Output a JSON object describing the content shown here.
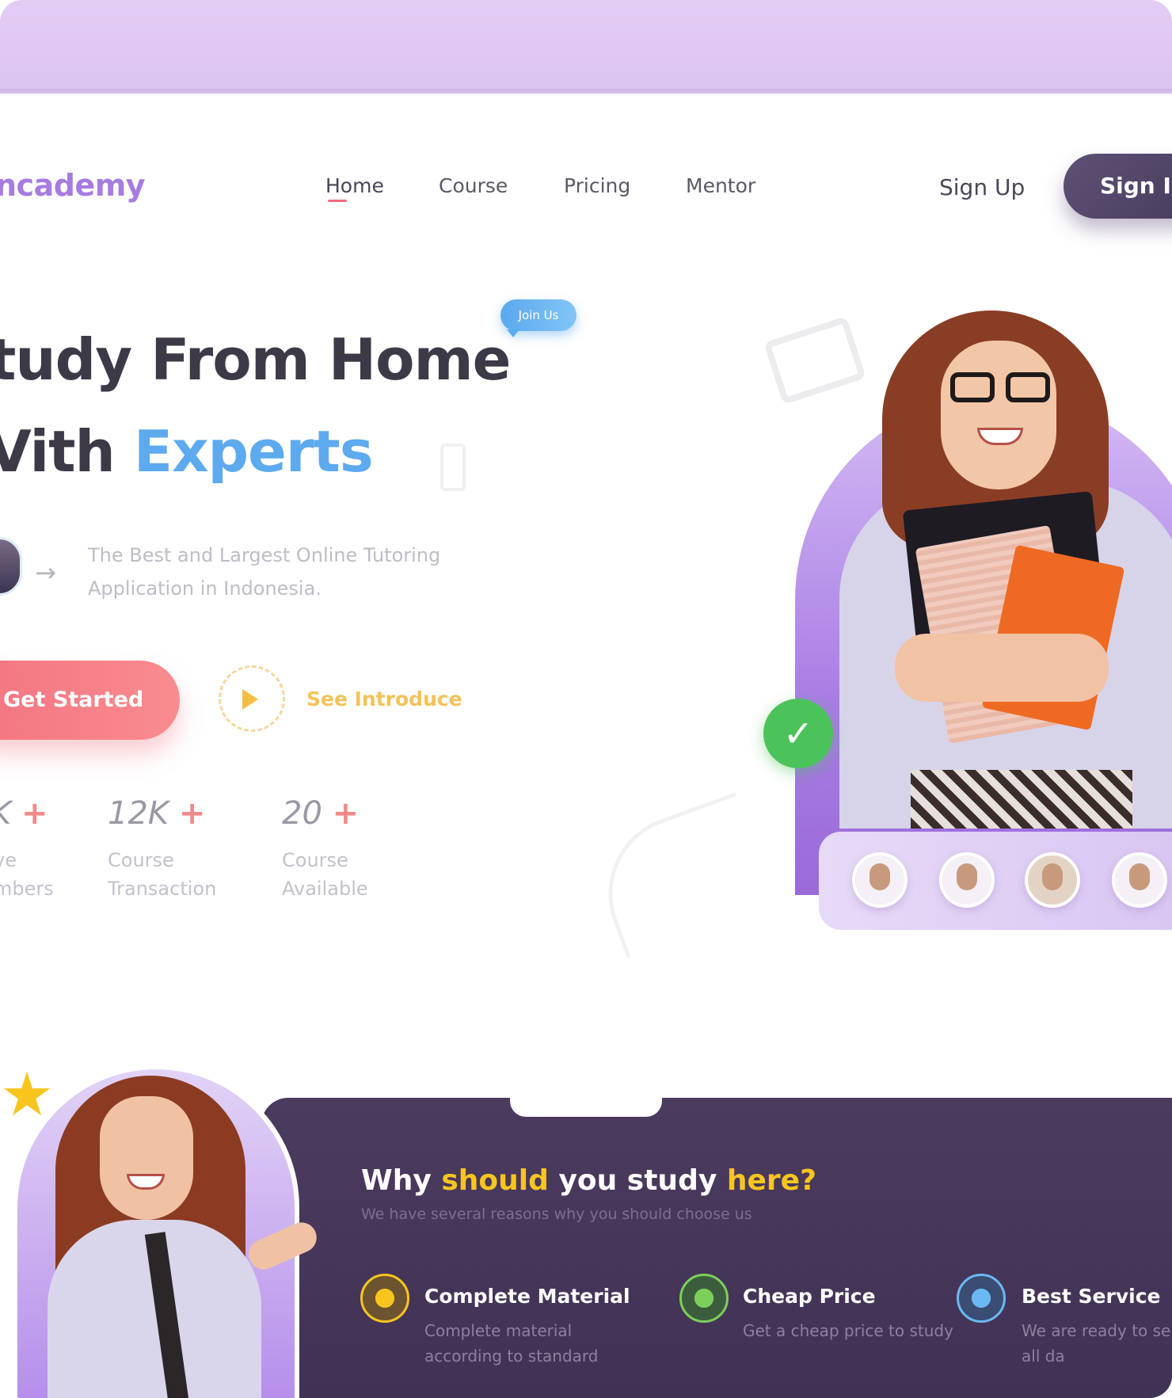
{
  "brand": {
    "logo": "ncademy"
  },
  "nav": {
    "links": [
      "Home",
      "Course",
      "Pricing",
      "Mentor"
    ],
    "active": "Home",
    "sign_up": "Sign Up",
    "sign_in": "Sign In"
  },
  "hero": {
    "badge": "Join Us",
    "title_line1": "tudy From Home",
    "title_line2_prefix": "Vith",
    "title_line2_accent": "Experts",
    "tagline": "The Best and Largest Online Tutoring Application in Indonesia.",
    "cta_primary": "Get Started",
    "cta_secondary": "See Introduce",
    "stats": [
      {
        "value": "K",
        "plus": "+",
        "label": "ve mbers"
      },
      {
        "value": "12K",
        "plus": "+",
        "label": "Course Transaction"
      },
      {
        "value": "20",
        "plus": "+",
        "label": "Course Available"
      }
    ],
    "check_mark": "✓"
  },
  "why": {
    "title_part1": "Why",
    "title_accent1": "should",
    "title_part2": "you study",
    "title_accent2": "here?",
    "subtitle": "We have several reasons why you should choose us",
    "features": [
      {
        "title": "Complete Material",
        "desc": "Complete material according to standard",
        "icon": "book-icon"
      },
      {
        "title": "Cheap Price",
        "desc": "Get a cheap price to study",
        "icon": "price-icon"
      },
      {
        "title": "Best Service",
        "desc": "We are ready to serve you all da",
        "icon": "service-icon"
      }
    ]
  },
  "colors": {
    "accent_blue": "#5daaee",
    "accent_red": "#f2727f",
    "accent_gold": "#f7c51e",
    "panel_purple": "#4b3b5f",
    "brand_purple": "#a77be0"
  }
}
